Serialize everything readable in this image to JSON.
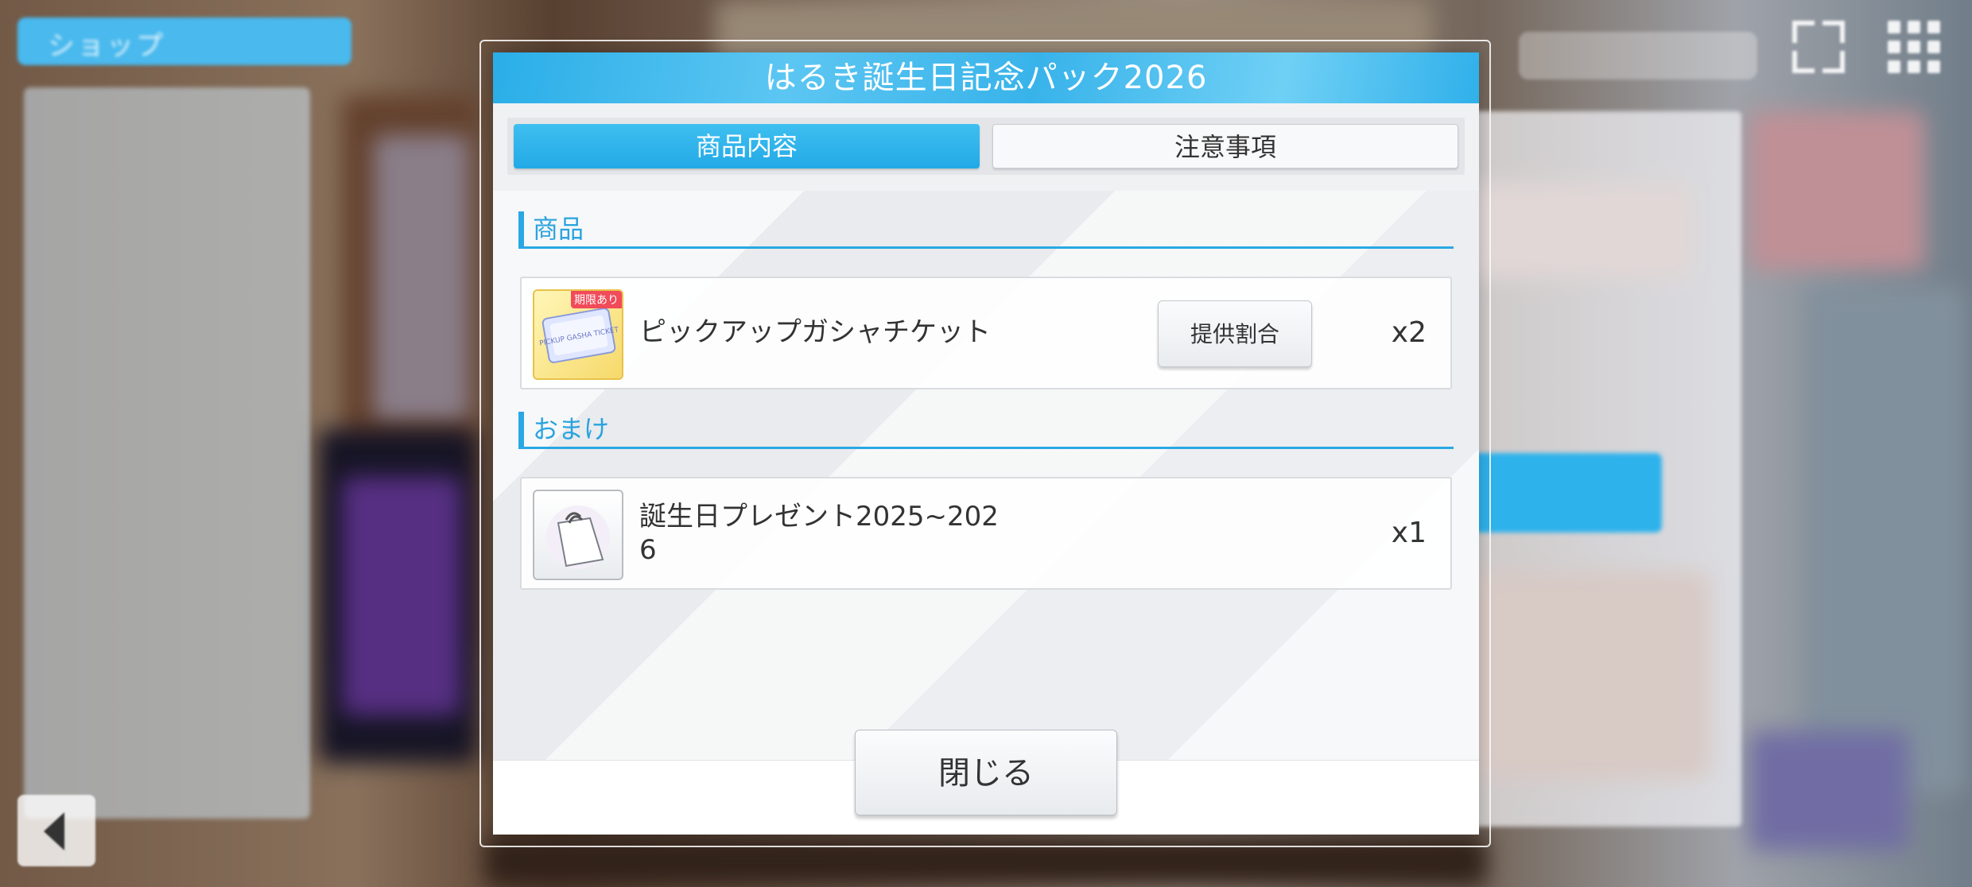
{
  "modal": {
    "title": "はるき誕生日記念パック2026",
    "tabs": [
      {
        "label": "商品内容",
        "active": true
      },
      {
        "label": "注意事項",
        "active": false
      }
    ],
    "sections": [
      {
        "heading": "商品",
        "items": [
          {
            "name_line1": "ピックアップガシャチケット",
            "name_line2": "",
            "quantity": "x2",
            "badge": "期限あり",
            "ticket_text": "PICKUP GASHA TICKET",
            "rate_button": "提供割合",
            "icon": "gasha-ticket-icon"
          }
        ]
      },
      {
        "heading": "おまけ",
        "items": [
          {
            "name_line1": "誕生日プレゼント2025~202",
            "name_line2": "6",
            "quantity": "x1",
            "icon": "gift-bag-icon"
          }
        ]
      }
    ],
    "close_label": "閉じる"
  },
  "background": {
    "shop_label": "ショップ"
  },
  "colors": {
    "accent": "#29a8e4",
    "header": "#2aaee8"
  }
}
